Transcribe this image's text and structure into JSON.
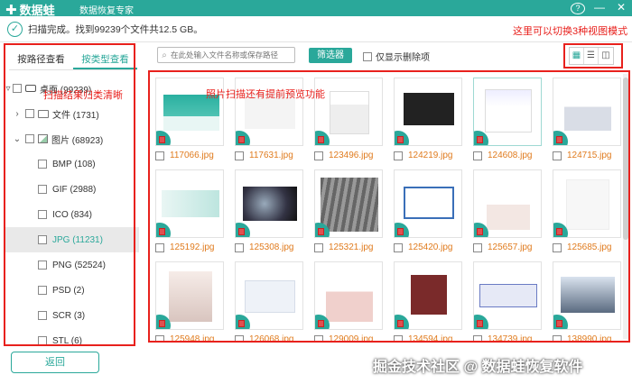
{
  "app": {
    "name": "数据蛙",
    "subtitle": "数据恢复专家"
  },
  "window": {
    "help": "?",
    "minimize": "—",
    "close": "✕"
  },
  "status": {
    "text": "扫描完成。找到99239个文件共12.5 GB。"
  },
  "annotations": {
    "view_modes": "这里可以切换3种视图模式",
    "classify": "扫描结果归类清晰",
    "preview": "照片扫描还有提前预览功能"
  },
  "tabs": [
    {
      "label": "按路径查看"
    },
    {
      "label": "按类型查看"
    }
  ],
  "tree": {
    "root": "桌面 (99239)",
    "documents": "文件 (1731)",
    "pictures": "图片 (68923)",
    "types": [
      "BMP (108)",
      "GIF (2988)",
      "ICO (834)",
      "JPG (11231)",
      "PNG (52524)",
      "PSD (2)",
      "SCR (3)",
      "STL (6)"
    ]
  },
  "toolbar": {
    "search_placeholder": "在此处输入文件名称或保存路径",
    "filter_label": "筛选器",
    "only_deleted_label": "仅显示删除项"
  },
  "files": [
    "117066.jpg",
    "117631.jpg",
    "123496.jpg",
    "124219.jpg",
    "124608.jpg",
    "124715.jpg",
    "125192.jpg",
    "125308.jpg",
    "125321.jpg",
    "125420.jpg",
    "125657.jpg",
    "125685.jpg",
    "125948.jpg",
    "126068.jpg",
    "129009.jpg",
    "134594.jpg",
    "134739.jpg",
    "138990.jpg"
  ],
  "back_label": "返回",
  "watermark": "掘金技术社区 @ 数据蛙恢复软件",
  "colors": {
    "accent": "#2aa89a",
    "annotation": "#e8211d",
    "filename": "#e07b1e"
  }
}
